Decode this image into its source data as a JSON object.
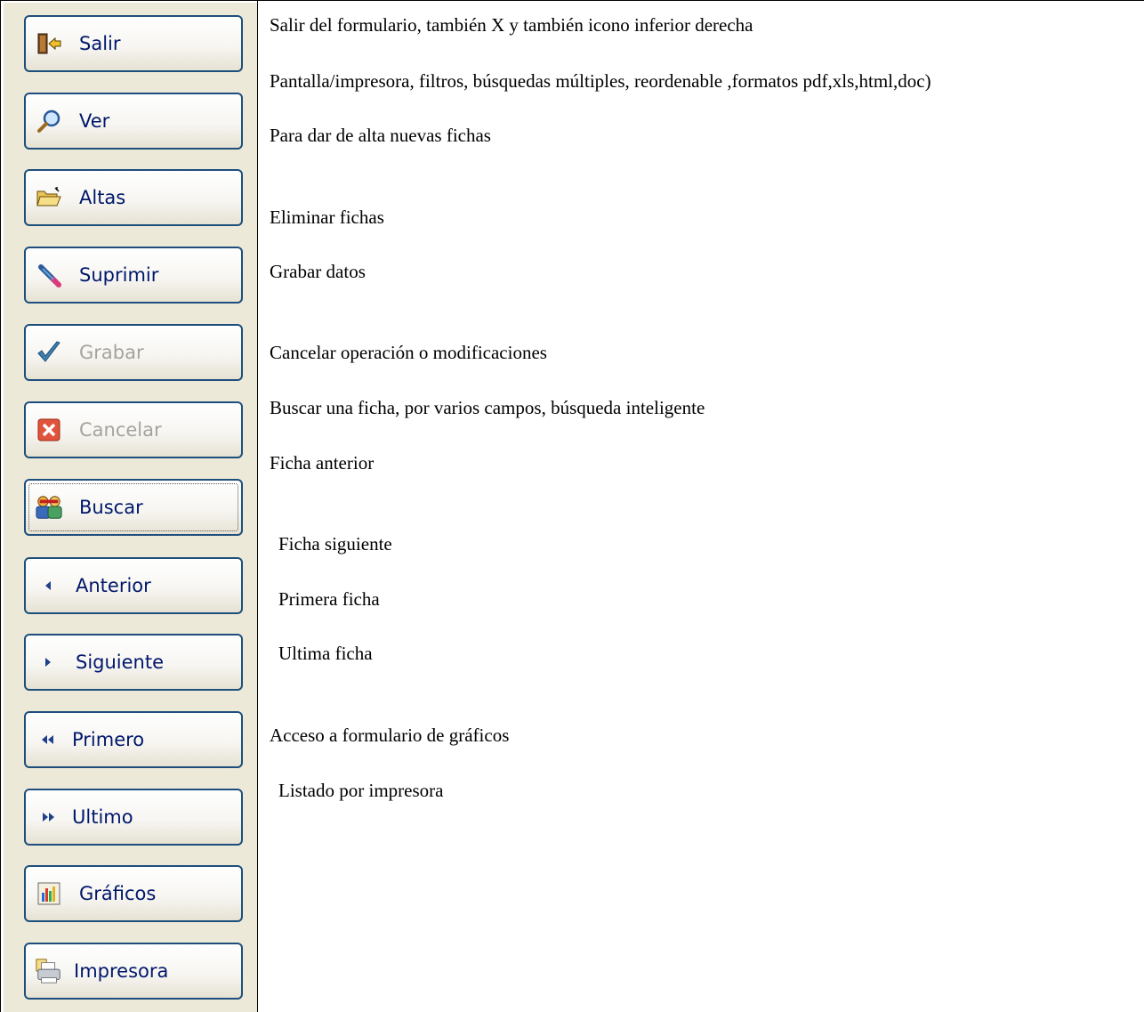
{
  "buttons": [
    {
      "label": "Salir",
      "icon": "door-exit-icon",
      "enabled": true
    },
    {
      "label": "Ver",
      "icon": "magnifier-icon",
      "enabled": true
    },
    {
      "label": "Altas",
      "icon": "open-folder-icon",
      "enabled": true
    },
    {
      "label": "Suprimir",
      "icon": "eraser-pencil-icon",
      "enabled": true
    },
    {
      "label": "Grabar",
      "icon": "checkmark-icon",
      "enabled": false
    },
    {
      "label": "Cancelar",
      "icon": "red-x-icon",
      "enabled": false
    },
    {
      "label": "Buscar",
      "icon": "people-search-icon",
      "enabled": true
    },
    {
      "label": "Anterior",
      "icon": "arrow-left-icon",
      "enabled": true
    },
    {
      "label": "Siguiente",
      "icon": "arrow-right-icon",
      "enabled": true
    },
    {
      "label": "Primero",
      "icon": "double-arrow-left-icon",
      "enabled": true
    },
    {
      "label": "Ultimo",
      "icon": "double-arrow-right-icon",
      "enabled": true
    },
    {
      "label": "Gráficos",
      "icon": "bar-chart-icon",
      "enabled": true
    },
    {
      "label": "Impresora",
      "icon": "printer-icon",
      "enabled": true
    }
  ],
  "descriptions": [
    "Salir del formulario, también X y también icono inferior derecha",
    "Pantalla/impresora, filtros, búsquedas múltiples, reordenable ,formatos pdf,xls,html,doc)",
    "Para dar de alta nuevas fichas",
    "Eliminar fichas",
    "Grabar datos",
    "Cancelar operación o modificaciones",
    "Buscar una ficha, por varios campos, búsqueda inteligente",
    "Ficha anterior",
    "Ficha siguiente",
    "Primera ficha",
    "Ultima ficha",
    "Acceso a formulario de gráficos",
    "Listado por impresora"
  ],
  "colors": {
    "panel": "#ece9d8",
    "button_border": "#1e4f7c",
    "button_text": "#00176b",
    "disabled_text": "#a5a39d"
  }
}
